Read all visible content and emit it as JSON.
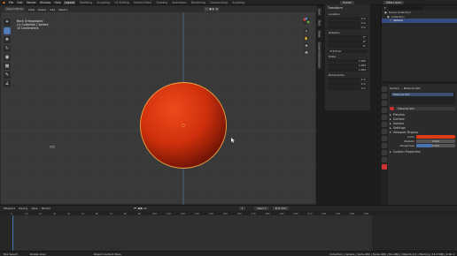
{
  "app": {
    "name": "Blender"
  },
  "menubar": {
    "items": [
      "File",
      "Edit",
      "Render",
      "Window",
      "Help"
    ]
  },
  "workspaces": {
    "tabs": [
      "Layout",
      "Modeling",
      "Sculpting",
      "UV Editing",
      "Texture Paint",
      "Shading",
      "Animation",
      "Rendering",
      "Compositing",
      "Scripting"
    ],
    "active": "Layout"
  },
  "scene": {
    "name": "Scene",
    "view_layer": "View Layer"
  },
  "viewport": {
    "header": [
      "Object Mode",
      "View",
      "Select",
      "Add",
      "Object"
    ],
    "overlay_lines": [
      "Back Orthographic",
      "(1) Collection | Sphere",
      "10 Centimeters"
    ],
    "sphere_color": "#d83a10",
    "accent": "#4772b3",
    "center_label": "◫◫"
  },
  "toolbar": {
    "icons": [
      "cursor-icon",
      "select-box-icon",
      "move-icon",
      "rotate-icon",
      "scale-icon",
      "transform-icon",
      "annotate-icon",
      "measure-icon"
    ]
  },
  "npanel": {
    "section": "Transform",
    "groups": [
      {
        "label": "Location",
        "values": [
          "0 m",
          "0 m",
          "0 m"
        ]
      },
      {
        "label": "Rotation",
        "values": [
          "0°",
          "0°",
          "0°"
        ]
      },
      {
        "label": "XYZ Euler",
        "values": []
      },
      {
        "label": "Scale",
        "values": [
          "1.000",
          "1.000",
          "1.000"
        ]
      },
      {
        "label": "Dimensions",
        "values": [
          "2 m",
          "2 m",
          "2 m"
        ]
      }
    ],
    "tabs": [
      "Item",
      "Tool",
      "View",
      "Sphere Distribution"
    ]
  },
  "outliner": {
    "rows": [
      {
        "label": "Scene Collection",
        "selected": false
      },
      {
        "label": "Collection",
        "selected": false
      },
      {
        "label": "Sphere",
        "selected": true
      }
    ]
  },
  "properties": {
    "breadcrumb": [
      "Sphere",
      "Material.001"
    ],
    "material_slot": "Material.001",
    "material_name": "Material.001",
    "sections": [
      "Preview",
      "Surface",
      "Volume",
      "Settings"
    ],
    "viewport_display": {
      "title": "Viewport Display",
      "color_label": "Color",
      "color": "#e03a12",
      "metallic_label": "Metallic",
      "metallic": "0.000",
      "roughness_label": "Roughness",
      "roughness": "0.400"
    },
    "custom_props": "Custom Properties"
  },
  "timeline": {
    "menu": [
      "Playback",
      "Keying",
      "View",
      "Marker"
    ],
    "current_frame": "1",
    "start_label": "Start",
    "start": "1",
    "end_label": "End",
    "end": "250",
    "ticks": [
      "0",
      "10",
      "20",
      "30",
      "40",
      "50",
      "60",
      "70",
      "80",
      "90",
      "100",
      "110",
      "120",
      "130",
      "140",
      "150",
      "160",
      "170",
      "180",
      "190",
      "200",
      "210",
      "220",
      "230",
      "240",
      "250"
    ]
  },
  "statusbar": {
    "items": [
      "Box Select",
      "Rotate View",
      "Object Context Menu"
    ],
    "stats": "Collection | Sphere | Verts:482 | Faces:480 | Tris:960 | Objects:1/1 | Memory: 23.2 MiB | 2.90.1"
  }
}
